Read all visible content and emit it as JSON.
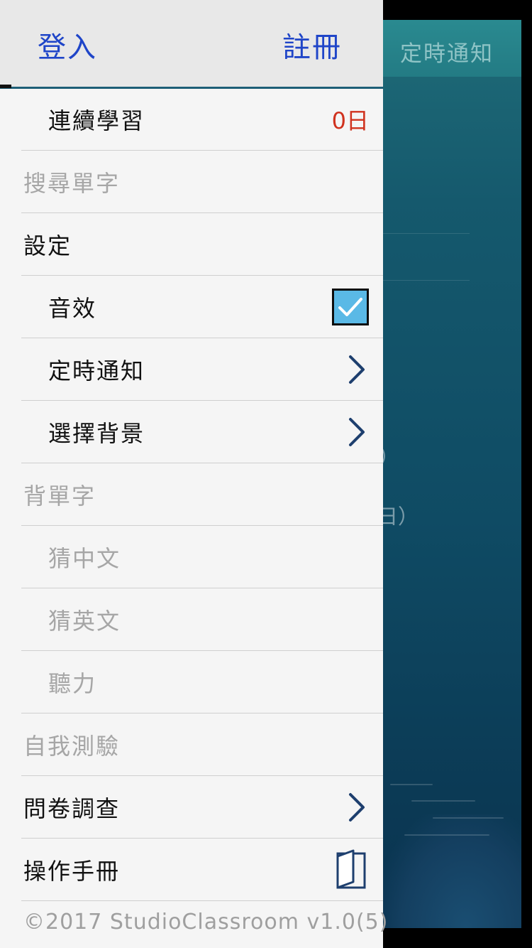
{
  "background_screen": {
    "title": "定時通知",
    "fragment_1": "）",
    "fragment_2": "日）"
  },
  "drawer": {
    "header": {
      "login": "登入",
      "register": "註冊"
    },
    "items": [
      {
        "label": "連續學習",
        "value": "0日",
        "style": "sub"
      },
      {
        "label": "搜尋單字",
        "style": "section-grey"
      },
      {
        "label": "設定",
        "style": "section-dark"
      },
      {
        "label": "音效",
        "style": "sub",
        "accessory": "checkbox",
        "checked": true
      },
      {
        "label": "定時通知",
        "style": "sub",
        "accessory": "chevron-right-icon"
      },
      {
        "label": "選擇背景",
        "style": "sub",
        "accessory": "chevron-right-icon"
      },
      {
        "label": "背單字",
        "style": "section-grey"
      },
      {
        "label": "猜中文",
        "style": "sub-grey"
      },
      {
        "label": "猜英文",
        "style": "sub-grey"
      },
      {
        "label": "聽力",
        "style": "sub-grey"
      },
      {
        "label": "自我測驗",
        "style": "section-grey"
      },
      {
        "label": "問卷調查",
        "style": "section-dark",
        "accessory": "chevron-right-icon"
      },
      {
        "label": "操作手冊",
        "style": "section-dark",
        "accessory": "book-icon"
      }
    ],
    "footer": "©2017 StudioClassroom v1.0(5)"
  },
  "colors": {
    "accent_blue": "#1f45c8",
    "streak_red": "#d0321e",
    "checkbox_fill": "#5ab9e6",
    "chevron": "#1e3f6e"
  }
}
